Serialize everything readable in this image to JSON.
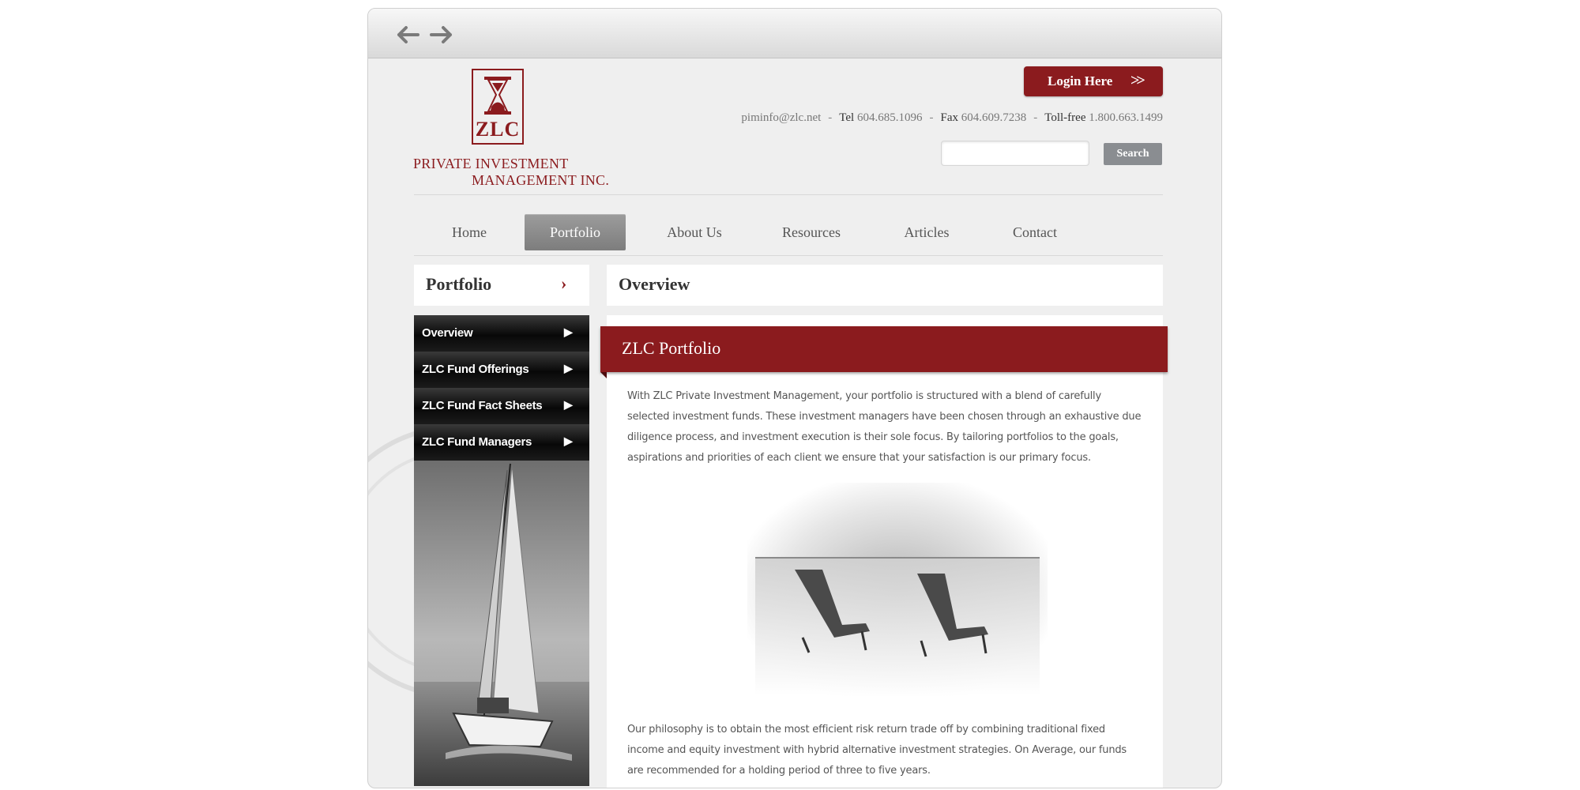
{
  "browser": {
    "back_label": "Back",
    "forward_label": "Forward"
  },
  "logo": {
    "mark": "ZLC",
    "line1": "PRIVATE INVESTMENT",
    "line2": "MANAGEMENT INC."
  },
  "header": {
    "login_label": "Login Here",
    "login_chevrons": ">>",
    "email": "piminfo@zlc.net",
    "tel_label": "Tel",
    "tel": "604.685.1096",
    "fax_label": "Fax",
    "fax": "604.609.7238",
    "tollfree_label": "Toll-free",
    "tollfree": "1.800.663.1499",
    "separator": "-",
    "search_value": "",
    "search_label": "Search"
  },
  "nav": {
    "items": [
      {
        "label": "Home"
      },
      {
        "label": "Portfolio",
        "active": true
      },
      {
        "label": "About Us"
      },
      {
        "label": "Resources"
      },
      {
        "label": "Articles"
      },
      {
        "label": "Contact"
      }
    ]
  },
  "sidebar": {
    "title": "Portfolio",
    "chevron": "›",
    "arrow": "▶",
    "items": [
      {
        "label": "Overview"
      },
      {
        "label": "ZLC Fund Offerings"
      },
      {
        "label": "ZLC Fund Fact Sheets"
      },
      {
        "label": "ZLC Fund Managers"
      }
    ]
  },
  "main": {
    "title": "Overview",
    "ribbon_title": "ZLC Portfolio",
    "paragraph1": "With ZLC Private Investment Management, your portfolio is structured with a blend of carefully selected investment funds. These investment managers have been chosen through an exhaustive due diligence process, and investment execution is their sole focus. By tailoring portfolios to the goals, aspirations and priorities of each client we ensure that your satisfaction is our primary focus.",
    "paragraph2": "Our philosophy is to obtain the most efficient risk return trade off by combining traditional fixed income and equity investment with hybrid alternative investment strategies. On Average, our funds are recommended for a holding period of three to five years."
  },
  "colors": {
    "brand": "#8b1b1e",
    "nav_active": "#8a8a8a",
    "search_button": "#8a8d91"
  },
  "icons": [
    "back-arrow-icon",
    "forward-arrow-icon",
    "hourglass-icon",
    "chevron-right-icon",
    "play-arrow-icon"
  ]
}
